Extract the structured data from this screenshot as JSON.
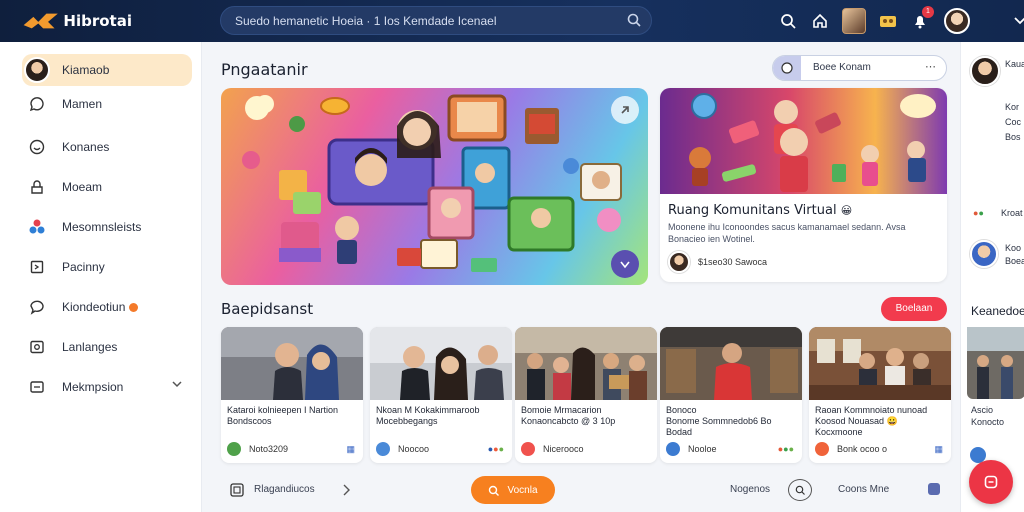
{
  "app": {
    "brand": "Hibrotai"
  },
  "search": {
    "text": "Suedo hemanetic Hoeia  · 1 Ios Kemdade Icenael"
  },
  "colors": {
    "topbar": "#12284f",
    "accent_orange": "#f7801f",
    "accent_red": "#f23b4d",
    "active_item": "#fde9c9"
  },
  "topbar_icons": [
    "search-icon",
    "home-icon",
    "profile-thumb-icon",
    "gallery-icon",
    "notification-icon",
    "user-avatar-icon",
    "chevron-down-icon"
  ],
  "notification_badge": "1",
  "sidebar": {
    "items": [
      {
        "label": "Kiamaob",
        "icon": "avatar"
      },
      {
        "label": "Mamen",
        "icon": "chat-icon"
      },
      {
        "label": "Konanes",
        "icon": "smile-icon"
      },
      {
        "label": "Moeam",
        "icon": "lock-icon"
      },
      {
        "label": "Mesomnsleists",
        "icon": "group-icon"
      },
      {
        "label": "Pacinny",
        "icon": "bookmark-icon"
      },
      {
        "label": "Kiondeotiun",
        "icon": "message-icon"
      },
      {
        "label": "Lanlanges",
        "icon": "image-icon"
      },
      {
        "label": "Mekmpsion",
        "icon": "window-icon"
      }
    ]
  },
  "main": {
    "section1_title": "Pngaatanir",
    "filter": {
      "label": "Boee Konam"
    },
    "featured": {
      "title": "Ruang Komunitans Virtual",
      "emoji": "😀",
      "description": "Moonene ihu Iconoondes sacus kamanamael sedann. Avsa Bonacieo ien Wotinel.",
      "meta": "$1seo30 Sawoca"
    },
    "section2_title": "Baepidsanst",
    "section2_button": "Boelaan",
    "cards": [
      {
        "title": "Kataroi kolnieepen I Nartion Bondscoos",
        "meta": "Noto3209",
        "tag": ""
      },
      {
        "title": "Nkoan M Kokakimmaroob Mocebbegangs",
        "meta": "Noocoo",
        "tag": ""
      },
      {
        "title": "Bomoie Mrmacarion Konaoncabcto @ 3 10p",
        "meta": "Nicerooco",
        "tag": ""
      },
      {
        "title": "Bonome Sommnedob6 Bo Bodad",
        "meta": "Nooloe",
        "tag": "Bonoco"
      },
      {
        "title": "Raoan Kommnoiato nunoad Koosod  Nouasad  😀",
        "meta": "Bonk ocoo o",
        "tag": "Kocxmoone"
      }
    ],
    "bottom": {
      "left_label": "Rlagandiucos",
      "center_button": "Vocnla",
      "right_label": "Nogenos",
      "far_right": "Coons  Mne"
    }
  },
  "right_panel": {
    "items": [
      "Kaua Kuh",
      "Kor Coc Bos",
      "Kroat",
      "Koo Boeai",
      "Keanedoe",
      "Ascio Konocto"
    ]
  }
}
